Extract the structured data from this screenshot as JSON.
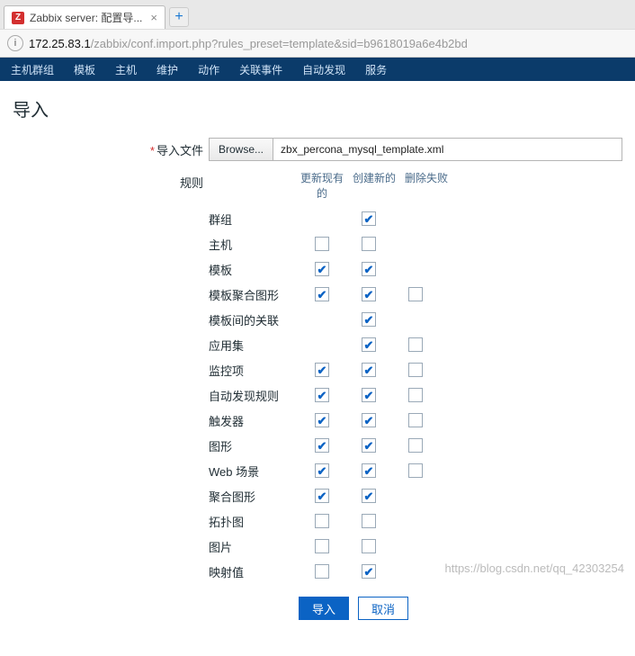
{
  "browser": {
    "tab_title": "Zabbix server: 配置导...",
    "favicon_text": "Z",
    "url_host": "172.25.83.1",
    "url_path": "/zabbix/conf.import.php?rules_preset=template&sid=b9618019a6e4b2bd"
  },
  "nav": {
    "items": [
      "主机群组",
      "模板",
      "主机",
      "维护",
      "动作",
      "关联事件",
      "自动发现",
      "服务"
    ]
  },
  "page": {
    "title": "导入"
  },
  "form": {
    "file_label": "导入文件",
    "browse_label": "Browse...",
    "file_name": "zbx_percona_mysql_template.xml",
    "rules_label": "规则",
    "col_update": "更新现有的",
    "col_create": "创建新的",
    "col_delete": "删除失败",
    "rules": [
      {
        "label": "群组",
        "update": null,
        "create": true,
        "delete": null
      },
      {
        "label": "主机",
        "update": false,
        "create": false,
        "delete": null
      },
      {
        "label": "模板",
        "update": true,
        "create": true,
        "delete": null
      },
      {
        "label": "模板聚合图形",
        "update": true,
        "create": true,
        "delete": false
      },
      {
        "label": "模板间的关联",
        "update": null,
        "create": true,
        "delete": null
      },
      {
        "label": "应用集",
        "update": null,
        "create": true,
        "delete": false
      },
      {
        "label": "监控项",
        "update": true,
        "create": true,
        "delete": false
      },
      {
        "label": "自动发现规则",
        "update": true,
        "create": true,
        "delete": false
      },
      {
        "label": "触发器",
        "update": true,
        "create": true,
        "delete": false
      },
      {
        "label": "图形",
        "update": true,
        "create": true,
        "delete": false
      },
      {
        "label": "Web 场景",
        "update": true,
        "create": true,
        "delete": false
      },
      {
        "label": "聚合图形",
        "update": true,
        "create": true,
        "delete": null
      },
      {
        "label": "拓扑图",
        "update": false,
        "create": false,
        "delete": null
      },
      {
        "label": "图片",
        "update": false,
        "create": false,
        "delete": null
      },
      {
        "label": "映射值",
        "update": false,
        "create": true,
        "delete": null
      }
    ],
    "submit_label": "导入",
    "cancel_label": "取消"
  },
  "watermark": "https://blog.csdn.net/qq_42303254"
}
